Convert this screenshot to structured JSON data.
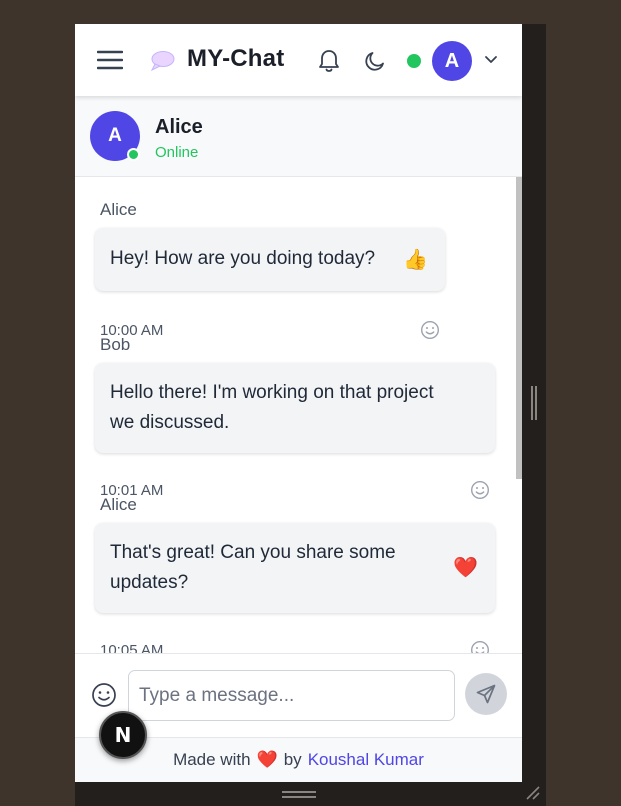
{
  "app": {
    "title": "MY-Chat",
    "user_initial": "A",
    "status_color": "#22c55e",
    "accent": "#4f46e5",
    "icons": {
      "menu": "hamburger-menu-icon",
      "brand": "speech-bubble-icon",
      "notifications": "bell-icon",
      "theme": "moon-icon",
      "account_menu": "chevron-down-icon"
    }
  },
  "contact": {
    "initial": "A",
    "name": "Alice",
    "status": "Online"
  },
  "messages": [
    {
      "sender": "Alice",
      "text": "Hey! How are you doing today?",
      "reaction": "👍",
      "time": "10:00 AM"
    },
    {
      "sender": "Bob",
      "text_line1": "Hello there! I'm working on that project",
      "text_line2": "we discussed.",
      "reaction": "",
      "time": "10:01 AM"
    },
    {
      "sender": "Alice",
      "text_line1": "That's great! Can you share some",
      "text_line2": "updates?",
      "reaction": "❤️",
      "time": "10:05 AM"
    }
  ],
  "composer": {
    "placeholder": "Type a message...",
    "value": ""
  },
  "footer": {
    "made_with": "Made with",
    "heart": "❤️",
    "by": "by",
    "author": "Koushal Kumar"
  },
  "dev_badge": "N"
}
